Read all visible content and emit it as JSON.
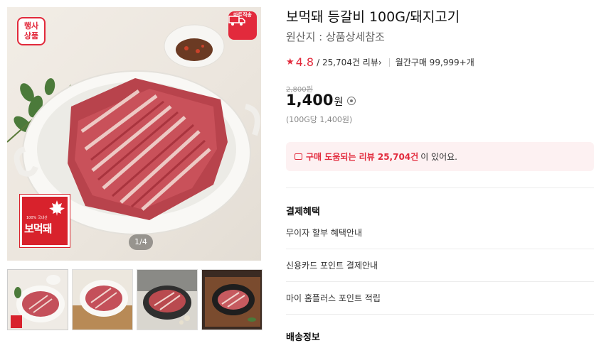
{
  "product": {
    "title": "보먹돼 등갈비 100G/돼지고기",
    "origin": "원산지 : 상품상세참조",
    "rating": "4.8",
    "review_count": "/ 25,704건 리뷰",
    "review_arrow": "›",
    "monthly_purchases": "월간구매 99,999+개",
    "original_price": "2,800원",
    "price": "1,400",
    "price_unit": "원",
    "unit_price": "(100G당 1,400원)"
  },
  "main_image": {
    "event_badge": "행사\n상품",
    "event_badge_line1": "행사",
    "event_badge_line2": "상품",
    "delivery_badge": "마트직송",
    "brand_tiny": "100% 국내산",
    "brand_name": "보먹돼",
    "counter": "1/4"
  },
  "review_banner": {
    "highlight": "구매 도움되는 리뷰 25,704건",
    "rest": "이 있어요."
  },
  "payment_benefits": {
    "title": "결제혜택",
    "items": [
      "무이자 할부 혜택안내",
      "신용카드 포인트 결제안내",
      "마이 홈플러스 포인트 적립"
    ]
  },
  "shipping": {
    "title": "배송정보"
  },
  "colors": {
    "accent": "#e22a3c",
    "banner_bg": "#fdf1f2"
  }
}
